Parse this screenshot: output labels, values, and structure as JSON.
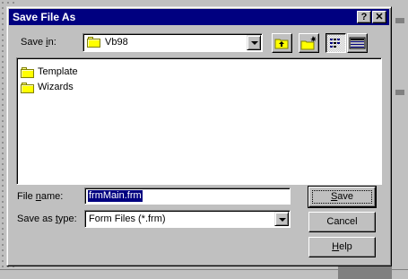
{
  "dialog": {
    "title": "Save File As",
    "help_glyph": "?",
    "close_glyph": "✕"
  },
  "save_in": {
    "label_pre": "Save ",
    "label_underlined": "i",
    "label_post": "n:",
    "value": "Vb98"
  },
  "toolbar": {
    "up_icon": "up-folder-icon",
    "new_folder_icon": "new-folder-icon",
    "list_view_icon": "list-view-icon",
    "details_view_icon": "details-view-icon"
  },
  "files": [
    {
      "name": "Template",
      "icon": "folder-icon"
    },
    {
      "name": "Wizards",
      "icon": "folder-icon"
    }
  ],
  "file_name": {
    "label_pre": "File ",
    "label_underlined": "n",
    "label_post": "ame:",
    "value": "frmMain.frm"
  },
  "save_as_type": {
    "label_pre": "Save as ",
    "label_underlined": "t",
    "label_post": "ype:",
    "value": "Form Files (*.frm)"
  },
  "buttons": {
    "save_underlined": "S",
    "save_rest": "ave",
    "cancel": "Cancel",
    "help_underlined": "H",
    "help_rest": "elp"
  },
  "colors": {
    "titlebar": "#000080",
    "face": "#c0c0c0",
    "selection": "#000080"
  }
}
